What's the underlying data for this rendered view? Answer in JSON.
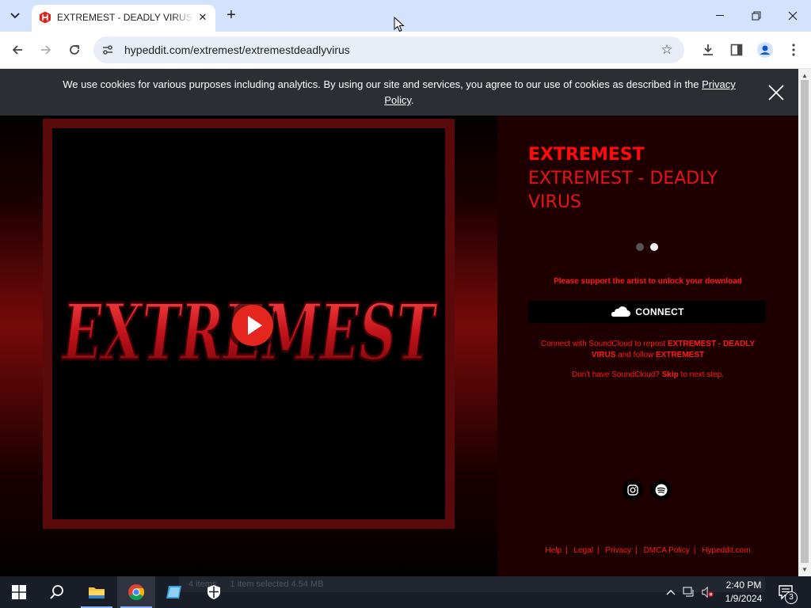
{
  "browser": {
    "tab_title": "EXTREMEST - DEADLY VIRUS by EXTREMEST",
    "url": "hypeddit.com/extremest/extremestdeadlyvirus",
    "favicon_icon": "hypeddit-h-icon"
  },
  "cookie_banner": {
    "text": "We use cookies for various purposes including analytics. By using our site and services, you agree to our use of cookies as described in the ",
    "link_text": "Privacy Policy",
    "suffix": "."
  },
  "artwork": {
    "logo_text": "EXTREMEST"
  },
  "release": {
    "artist": "EXTREMEST",
    "title": "EXTREMEST - DEADLY VIRUS",
    "steps_total": 2,
    "steps_active": 2
  },
  "unlock": {
    "prompt": "Please support the artist to unlock your download",
    "connect_label": "CONNECT",
    "desc_pre": "Connect with SoundCloud to repost ",
    "desc_track": "EXTREMEST - DEADLY VIRUS",
    "desc_mid": " and follow ",
    "desc_artist": "EXTREMEST",
    "skip_pre": "Don't have SoundCloud? ",
    "skip_link": "Skip",
    "skip_post": " to next step."
  },
  "footer": {
    "links": [
      "Help",
      "Legal",
      "Privacy",
      "DMCA Policy",
      "Hypeddit.com"
    ]
  },
  "taskbar": {
    "explorer_items": "4 items",
    "explorer_selected": "1 item selected  4.54 MB",
    "time": "2:40 PM",
    "date": "1/9/2024",
    "notification_count": "3"
  },
  "colors": {
    "accent_red": "#ff0b0b",
    "play_red": "#e5261f",
    "right_panel": "#1f0000",
    "cookie_bar": "#2b2f33"
  }
}
